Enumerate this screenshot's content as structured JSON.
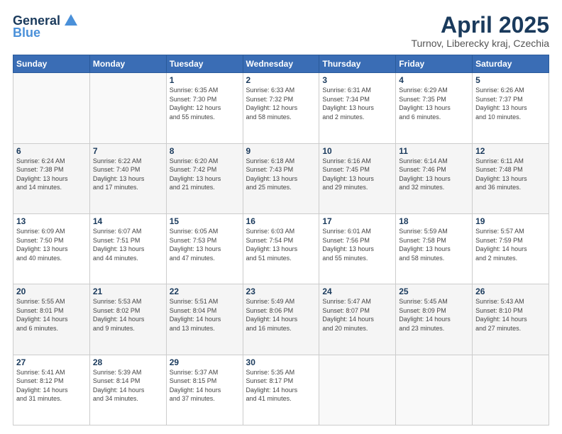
{
  "header": {
    "logo_general": "General",
    "logo_blue": "Blue",
    "title": "April 2025",
    "subtitle": "Turnov, Liberecky kraj, Czechia"
  },
  "weekdays": [
    "Sunday",
    "Monday",
    "Tuesday",
    "Wednesday",
    "Thursday",
    "Friday",
    "Saturday"
  ],
  "weeks": [
    [
      {
        "day": "",
        "info": ""
      },
      {
        "day": "",
        "info": ""
      },
      {
        "day": "1",
        "info": "Sunrise: 6:35 AM\nSunset: 7:30 PM\nDaylight: 12 hours\nand 55 minutes."
      },
      {
        "day": "2",
        "info": "Sunrise: 6:33 AM\nSunset: 7:32 PM\nDaylight: 12 hours\nand 58 minutes."
      },
      {
        "day": "3",
        "info": "Sunrise: 6:31 AM\nSunset: 7:34 PM\nDaylight: 13 hours\nand 2 minutes."
      },
      {
        "day": "4",
        "info": "Sunrise: 6:29 AM\nSunset: 7:35 PM\nDaylight: 13 hours\nand 6 minutes."
      },
      {
        "day": "5",
        "info": "Sunrise: 6:26 AM\nSunset: 7:37 PM\nDaylight: 13 hours\nand 10 minutes."
      }
    ],
    [
      {
        "day": "6",
        "info": "Sunrise: 6:24 AM\nSunset: 7:38 PM\nDaylight: 13 hours\nand 14 minutes."
      },
      {
        "day": "7",
        "info": "Sunrise: 6:22 AM\nSunset: 7:40 PM\nDaylight: 13 hours\nand 17 minutes."
      },
      {
        "day": "8",
        "info": "Sunrise: 6:20 AM\nSunset: 7:42 PM\nDaylight: 13 hours\nand 21 minutes."
      },
      {
        "day": "9",
        "info": "Sunrise: 6:18 AM\nSunset: 7:43 PM\nDaylight: 13 hours\nand 25 minutes."
      },
      {
        "day": "10",
        "info": "Sunrise: 6:16 AM\nSunset: 7:45 PM\nDaylight: 13 hours\nand 29 minutes."
      },
      {
        "day": "11",
        "info": "Sunrise: 6:14 AM\nSunset: 7:46 PM\nDaylight: 13 hours\nand 32 minutes."
      },
      {
        "day": "12",
        "info": "Sunrise: 6:11 AM\nSunset: 7:48 PM\nDaylight: 13 hours\nand 36 minutes."
      }
    ],
    [
      {
        "day": "13",
        "info": "Sunrise: 6:09 AM\nSunset: 7:50 PM\nDaylight: 13 hours\nand 40 minutes."
      },
      {
        "day": "14",
        "info": "Sunrise: 6:07 AM\nSunset: 7:51 PM\nDaylight: 13 hours\nand 44 minutes."
      },
      {
        "day": "15",
        "info": "Sunrise: 6:05 AM\nSunset: 7:53 PM\nDaylight: 13 hours\nand 47 minutes."
      },
      {
        "day": "16",
        "info": "Sunrise: 6:03 AM\nSunset: 7:54 PM\nDaylight: 13 hours\nand 51 minutes."
      },
      {
        "day": "17",
        "info": "Sunrise: 6:01 AM\nSunset: 7:56 PM\nDaylight: 13 hours\nand 55 minutes."
      },
      {
        "day": "18",
        "info": "Sunrise: 5:59 AM\nSunset: 7:58 PM\nDaylight: 13 hours\nand 58 minutes."
      },
      {
        "day": "19",
        "info": "Sunrise: 5:57 AM\nSunset: 7:59 PM\nDaylight: 14 hours\nand 2 minutes."
      }
    ],
    [
      {
        "day": "20",
        "info": "Sunrise: 5:55 AM\nSunset: 8:01 PM\nDaylight: 14 hours\nand 6 minutes."
      },
      {
        "day": "21",
        "info": "Sunrise: 5:53 AM\nSunset: 8:02 PM\nDaylight: 14 hours\nand 9 minutes."
      },
      {
        "day": "22",
        "info": "Sunrise: 5:51 AM\nSunset: 8:04 PM\nDaylight: 14 hours\nand 13 minutes."
      },
      {
        "day": "23",
        "info": "Sunrise: 5:49 AM\nSunset: 8:06 PM\nDaylight: 14 hours\nand 16 minutes."
      },
      {
        "day": "24",
        "info": "Sunrise: 5:47 AM\nSunset: 8:07 PM\nDaylight: 14 hours\nand 20 minutes."
      },
      {
        "day": "25",
        "info": "Sunrise: 5:45 AM\nSunset: 8:09 PM\nDaylight: 14 hours\nand 23 minutes."
      },
      {
        "day": "26",
        "info": "Sunrise: 5:43 AM\nSunset: 8:10 PM\nDaylight: 14 hours\nand 27 minutes."
      }
    ],
    [
      {
        "day": "27",
        "info": "Sunrise: 5:41 AM\nSunset: 8:12 PM\nDaylight: 14 hours\nand 31 minutes."
      },
      {
        "day": "28",
        "info": "Sunrise: 5:39 AM\nSunset: 8:14 PM\nDaylight: 14 hours\nand 34 minutes."
      },
      {
        "day": "29",
        "info": "Sunrise: 5:37 AM\nSunset: 8:15 PM\nDaylight: 14 hours\nand 37 minutes."
      },
      {
        "day": "30",
        "info": "Sunrise: 5:35 AM\nSunset: 8:17 PM\nDaylight: 14 hours\nand 41 minutes."
      },
      {
        "day": "",
        "info": ""
      },
      {
        "day": "",
        "info": ""
      },
      {
        "day": "",
        "info": ""
      }
    ]
  ]
}
